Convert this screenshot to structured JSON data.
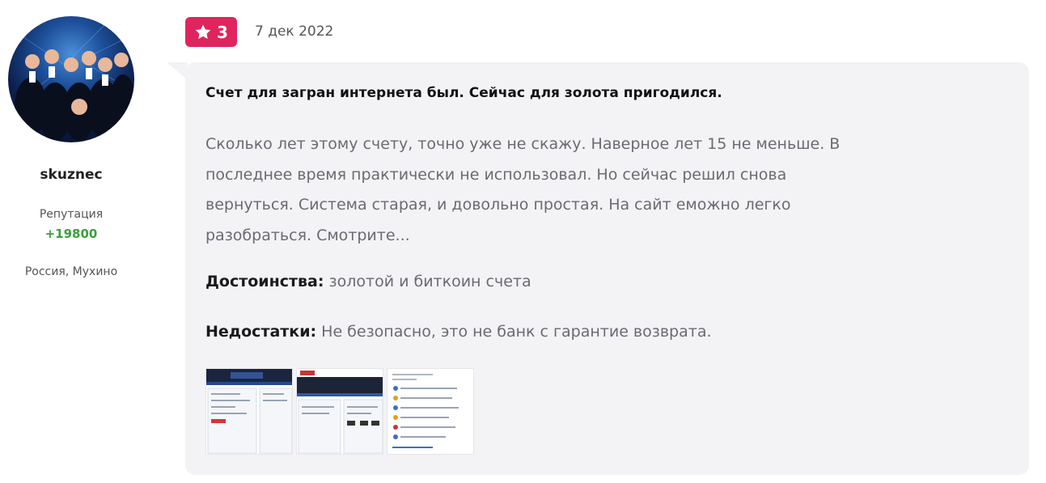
{
  "author": {
    "name": "skuznec",
    "reputation_label": "Репутация",
    "reputation_value": "+19800",
    "location": "Россия, Мухино"
  },
  "review": {
    "rating": "3",
    "date": "7 дек 2022",
    "title": "Счет для загран интернета был. Сейчас для золота пригодился.",
    "text_lines": [
      "Сколько лет этому счету, точно уже не скажу. Наверное лет 15 не меньше. В",
      "последнее время практически не использовал. Но сейчас решил снова",
      "вернуться. Система старая, и довольно простая. На сайт еможно легко",
      "разобраться. Смотрите..."
    ],
    "pros_label": "Достоинства:",
    "pros_value": "золотой и биткоин счета",
    "cons_label": "Недостатки:",
    "cons_value": "Не безопасно, это не банк с гарантие возврата."
  },
  "colors": {
    "badge": "#e0245e",
    "bubble": "#f3f3f6",
    "reputation": "#3aa13a"
  },
  "icons": {
    "rating": "star-icon"
  }
}
